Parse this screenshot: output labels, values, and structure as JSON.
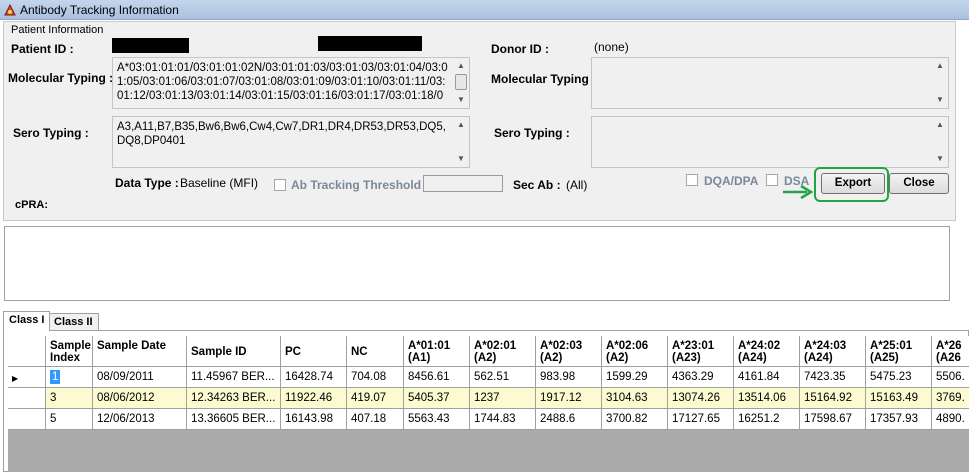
{
  "window": {
    "title": "Antibody Tracking Information",
    "icon": "app-icon"
  },
  "patient_info": {
    "group_title": "Patient Information",
    "patient_id_label": "Patient ID :",
    "molecular_typing_label": "Molecular Typing :",
    "molecular_typing_value": "A*03:01:01:01/03:01:01:02N/03:01:01:03/03:01:03/03:01:04/03:01:05/03:01:06/03:01:07/03:01:08/03:01:09/03:01:10/03:01:11/03:01:12/03:01:13/03:01:14/03:01:15/03:01:16/03:01:17/03:01:18/0",
    "sero_typing_label": "Sero Typing :",
    "sero_typing_value": "A3,A11,B7,B35,Bw6,Bw6,Cw4,Cw7,DR1,DR4,DR53,DR53,DQ5,DQ8,DP0401",
    "data_type_label": "Data Type :",
    "data_type_value": "Baseline (MFI)",
    "ab_tracking_threshold_label": "Ab Tracking Threshold",
    "sec_ab_label": "Sec Ab :",
    "sec_ab_value": "(All)",
    "cpra_label": "cPRA:"
  },
  "donor_info": {
    "donor_id_label": "Donor ID :",
    "donor_id_value": "(none)",
    "molecular_typing_label": "Molecular Typing :",
    "sero_typing_label": "Sero Typing :"
  },
  "controls": {
    "dqa_dpa_label": "DQA/DPA",
    "dsa_label": "DSA",
    "export_label": "Export",
    "close_label": "Close"
  },
  "tabs": [
    {
      "label": "Class I",
      "active": true
    },
    {
      "label": "Class II",
      "active": false
    }
  ],
  "grid": {
    "columns": [
      {
        "label": "Sample Index"
      },
      {
        "label": "Sample Date"
      },
      {
        "label": "Sample ID"
      },
      {
        "label": "PC"
      },
      {
        "label": "NC"
      },
      {
        "label": "A*01:01 (A1)"
      },
      {
        "label": "A*02:01 (A2)"
      },
      {
        "label": "A*02:03 (A2)"
      },
      {
        "label": "A*02:06 (A2)"
      },
      {
        "label": "A*23:01 (A23)"
      },
      {
        "label": "A*24:02 (A24)"
      },
      {
        "label": "A*24:03 (A24)"
      },
      {
        "label": "A*25:01 (A25)"
      },
      {
        "label": "A*26 (A26"
      }
    ],
    "rows": [
      [
        "1",
        "08/09/2011",
        "11.45967 BER...",
        "16428.74",
        "704.08",
        "8456.61",
        "562.51",
        "983.98",
        "1599.29",
        "4363.29",
        "4161.84",
        "7423.35",
        "5475.23",
        "5506."
      ],
      [
        "3",
        "08/06/2012",
        "12.34263 BER...",
        "11922.46",
        "419.07",
        "5405.37",
        "1237",
        "1917.12",
        "3104.63",
        "13074.26",
        "13514.06",
        "15164.92",
        "15163.49",
        "3769."
      ],
      [
        "5",
        "12/06/2013",
        "13.36605 BER...",
        "16143.98",
        "407.18",
        "5563.43",
        "1744.83",
        "2488.6",
        "3700.82",
        "17127.65",
        "16251.2",
        "17598.67",
        "17357.93",
        "4890."
      ]
    ],
    "selected_row": 0
  },
  "colors": {
    "highlight": "#22a34a",
    "alt_row": "#fbfad0",
    "selection": "#3399ff",
    "grid_background": "#ababab"
  }
}
